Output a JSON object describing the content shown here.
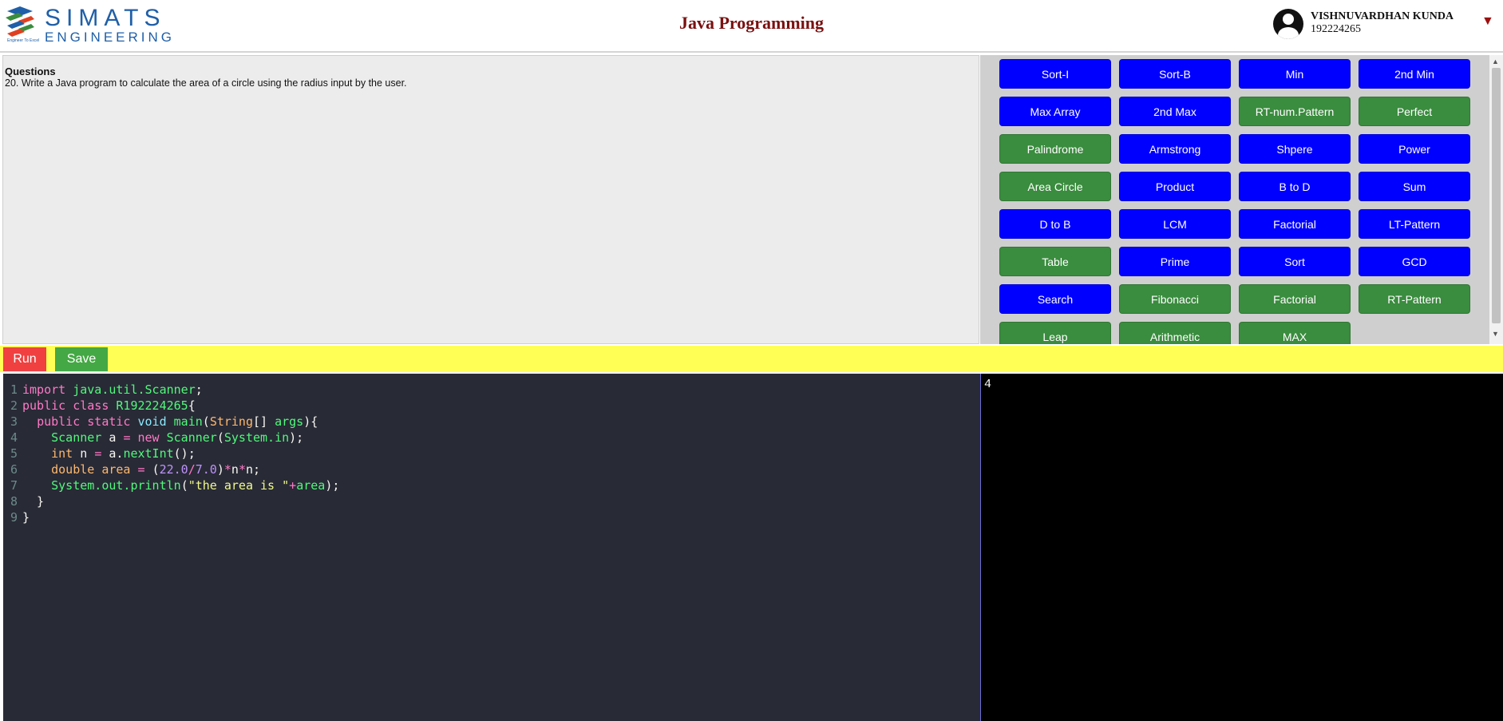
{
  "header": {
    "logo_title": "SIMATS",
    "logo_subtitle": "ENGINEERING",
    "logo_tagline": "Engineer To Excel",
    "page_title": "Java Programming",
    "user_name": "VISHNUVARDHAN KUNDA",
    "user_id": "192224265",
    "dropdown_icon": "caret-down-icon"
  },
  "question": {
    "heading": "Questions",
    "text": "20. Write a Java program to calculate the area of a circle using the radius input by the user."
  },
  "program_buttons": [
    {
      "label": "Sort-I",
      "color": "blue"
    },
    {
      "label": "Sort-B",
      "color": "blue"
    },
    {
      "label": "Min",
      "color": "blue"
    },
    {
      "label": "2nd Min",
      "color": "blue"
    },
    {
      "label": "Max Array",
      "color": "blue"
    },
    {
      "label": "2nd Max",
      "color": "blue"
    },
    {
      "label": "RT-num.Pattern",
      "color": "green"
    },
    {
      "label": "Perfect",
      "color": "green"
    },
    {
      "label": "Palindrome",
      "color": "green"
    },
    {
      "label": "Armstrong",
      "color": "blue"
    },
    {
      "label": "Shpere",
      "color": "blue"
    },
    {
      "label": "Power",
      "color": "blue"
    },
    {
      "label": "Area Circle",
      "color": "green"
    },
    {
      "label": "Product",
      "color": "blue"
    },
    {
      "label": "B to D",
      "color": "blue"
    },
    {
      "label": "Sum",
      "color": "blue"
    },
    {
      "label": "D to B",
      "color": "blue"
    },
    {
      "label": "LCM",
      "color": "blue"
    },
    {
      "label": "Factorial",
      "color": "blue"
    },
    {
      "label": "LT-Pattern",
      "color": "blue"
    },
    {
      "label": "Table",
      "color": "green"
    },
    {
      "label": "Prime",
      "color": "blue"
    },
    {
      "label": "Sort",
      "color": "blue"
    },
    {
      "label": "GCD",
      "color": "blue"
    },
    {
      "label": "Search",
      "color": "blue"
    },
    {
      "label": "Fibonacci",
      "color": "green"
    },
    {
      "label": "Factorial",
      "color": "green"
    },
    {
      "label": "RT-Pattern",
      "color": "green"
    },
    {
      "label": "Leap",
      "color": "green"
    },
    {
      "label": "Arithmetic",
      "color": "green"
    },
    {
      "label": "MAX",
      "color": "green"
    }
  ],
  "toolbar": {
    "run_label": "Run",
    "save_label": "Save"
  },
  "editor": {
    "lines": [
      {
        "n": "1",
        "tokens": [
          [
            "kw",
            "import "
          ],
          [
            "cls",
            "java.util.Scanner"
          ],
          [
            "txt",
            ";"
          ]
        ]
      },
      {
        "n": "2",
        "tokens": [
          [
            "kw",
            "public class "
          ],
          [
            "cls",
            "R192224265"
          ],
          [
            "txt",
            "{"
          ]
        ]
      },
      {
        "n": "3",
        "tokens": [
          [
            "txt",
            "  "
          ],
          [
            "kw",
            "public static "
          ],
          [
            "ty",
            "void "
          ],
          [
            "cls",
            "main"
          ],
          [
            "txt",
            "("
          ],
          [
            "var",
            "String"
          ],
          [
            "txt",
            "[] "
          ],
          [
            "cls",
            "args"
          ],
          [
            "txt",
            "){"
          ]
        ]
      },
      {
        "n": "4",
        "tokens": [
          [
            "txt",
            "    "
          ],
          [
            "cls",
            "Scanner "
          ],
          [
            "txt",
            "a "
          ],
          [
            "kw",
            "= new "
          ],
          [
            "cls",
            "Scanner"
          ],
          [
            "txt",
            "("
          ],
          [
            "cls",
            "System.in"
          ],
          [
            "txt",
            ");"
          ]
        ]
      },
      {
        "n": "5",
        "tokens": [
          [
            "txt",
            "    "
          ],
          [
            "var",
            "int "
          ],
          [
            "txt",
            "n "
          ],
          [
            "kw",
            "= "
          ],
          [
            "txt",
            "a."
          ],
          [
            "cls",
            "nextInt"
          ],
          [
            "txt",
            "();"
          ]
        ]
      },
      {
        "n": "6",
        "tokens": [
          [
            "txt",
            "    "
          ],
          [
            "var",
            "double area "
          ],
          [
            "kw",
            "= "
          ],
          [
            "txt",
            "("
          ],
          [
            "num",
            "22.0"
          ],
          [
            "kw",
            "/"
          ],
          [
            "num",
            "7.0"
          ],
          [
            "txt",
            ")"
          ],
          [
            "kw",
            "*"
          ],
          [
            "txt",
            "n"
          ],
          [
            "kw",
            "*"
          ],
          [
            "txt",
            "n;"
          ]
        ]
      },
      {
        "n": "7",
        "tokens": [
          [
            "txt",
            "    "
          ],
          [
            "cls",
            "System.out.println"
          ],
          [
            "txt",
            "("
          ],
          [
            "str",
            "\"the area is \""
          ],
          [
            "kw",
            "+"
          ],
          [
            "cls",
            "area"
          ],
          [
            "txt",
            ");"
          ]
        ]
      },
      {
        "n": "8",
        "tokens": [
          [
            "txt",
            "  }"
          ]
        ]
      },
      {
        "n": "9",
        "tokens": [
          [
            "txt",
            "}"
          ]
        ]
      }
    ]
  },
  "output": {
    "text": "4"
  },
  "colors": {
    "blue_button": "#0000ff",
    "green_button": "#3a8c3e",
    "run_button": "#f04040",
    "save_button": "#44a844",
    "toolbar": "#ffff55",
    "editor_bg": "#282a36",
    "title": "#7a1010"
  }
}
